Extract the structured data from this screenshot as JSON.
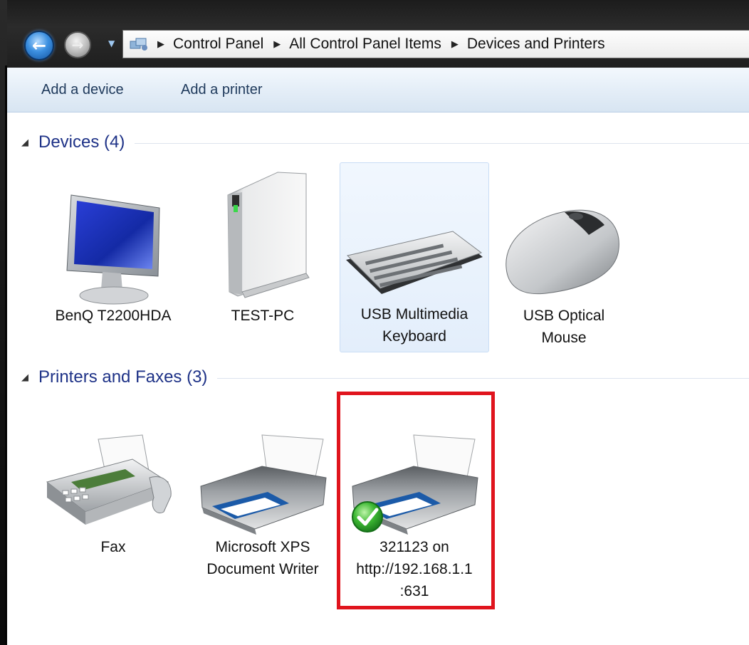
{
  "window": {
    "address": {
      "crumbs": [
        "Control Panel",
        "All Control Panel Items",
        "Devices and Printers"
      ]
    },
    "commands": {
      "add_device": "Add a device",
      "add_printer": "Add a printer"
    }
  },
  "groups": {
    "devices": {
      "title": "Devices (4)",
      "items": [
        {
          "label": "BenQ T2200HDA",
          "icon": "monitor-icon"
        },
        {
          "label": "TEST-PC",
          "icon": "computer-tower-icon"
        },
        {
          "label": "USB Multimedia\nKeyboard",
          "icon": "keyboard-icon",
          "selected": true
        },
        {
          "label": "USB Optical\nMouse",
          "icon": "mouse-icon"
        }
      ]
    },
    "printers": {
      "title": "Printers and Faxes (3)",
      "items": [
        {
          "label": "Fax",
          "icon": "fax-icon"
        },
        {
          "label": "Microsoft XPS\nDocument Writer",
          "icon": "printer-icon"
        },
        {
          "label": "321123 on\nhttp://192.168.1.1\n:631",
          "icon": "printer-icon",
          "default_badge": "checkmark-icon",
          "highlighted": true
        }
      ]
    }
  },
  "colors": {
    "group_title": "#1e3287",
    "highlight": "#e0141d",
    "selection_bg": "#e3eefb"
  }
}
